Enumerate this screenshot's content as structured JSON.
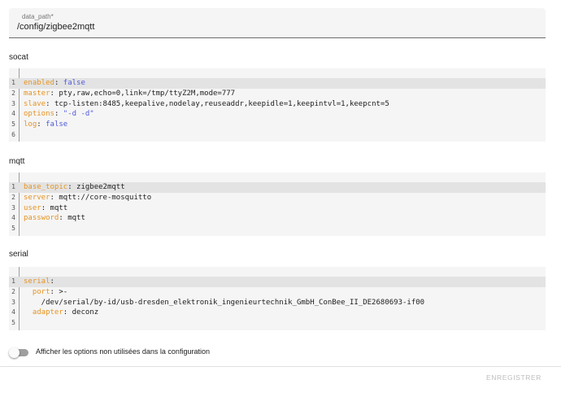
{
  "data_path": {
    "label": "data_path*",
    "value": "/config/zigbee2mqtt"
  },
  "sections": {
    "socat": {
      "title": "socat",
      "lines": [
        {
          "n": "1",
          "key": "enabled",
          "sep": ": ",
          "val": "false",
          "val_type": "bool"
        },
        {
          "n": "2",
          "key": "master",
          "sep": ": ",
          "val": "pty,raw,echo=0,link=/tmp/ttyZ2M,mode=777",
          "val_type": "plain"
        },
        {
          "n": "3",
          "key": "slave",
          "sep": ": ",
          "val": "tcp-listen:8485,keepalive,nodelay,reuseaddr,keepidle=1,keepintvl=1,keepcnt=5",
          "val_type": "plain"
        },
        {
          "n": "4",
          "key": "options",
          "sep": ": ",
          "val": "\"-d -d\"",
          "val_type": "string"
        },
        {
          "n": "5",
          "key": "log",
          "sep": ": ",
          "val": "false",
          "val_type": "bool"
        },
        {
          "n": "6",
          "key": "",
          "sep": "",
          "val": "",
          "val_type": "plain"
        }
      ]
    },
    "mqtt": {
      "title": "mqtt",
      "lines": [
        {
          "n": "1",
          "key": "base_topic",
          "sep": ": ",
          "val": "zigbee2mqtt",
          "val_type": "plain"
        },
        {
          "n": "2",
          "key": "server",
          "sep": ": ",
          "val": "mqtt://core-mosquitto",
          "val_type": "plain"
        },
        {
          "n": "3",
          "key": "user",
          "sep": ": ",
          "val": "mqtt",
          "val_type": "plain"
        },
        {
          "n": "4",
          "key": "password",
          "sep": ": ",
          "val": "mqtt",
          "val_type": "plain"
        },
        {
          "n": "5",
          "key": "",
          "sep": "",
          "val": "",
          "val_type": "plain"
        }
      ]
    },
    "serial": {
      "title": "serial",
      "lines": [
        {
          "n": "1",
          "key": "serial",
          "sep": ":",
          "val": "",
          "val_type": "plain"
        },
        {
          "n": "2",
          "key": "  port",
          "sep": ": ",
          "val": ">-",
          "val_type": "plain"
        },
        {
          "n": "3",
          "key": "",
          "sep": "",
          "val": "    /dev/serial/by-id/usb-dresden_elektronik_ingenieurtechnik_GmbH_ConBee_II_DE2680693-if00",
          "val_type": "plain"
        },
        {
          "n": "4",
          "key": "  adapter",
          "sep": ": ",
          "val": "deconz",
          "val_type": "plain"
        },
        {
          "n": "5",
          "key": "",
          "sep": "",
          "val": "",
          "val_type": "plain"
        }
      ]
    }
  },
  "toggle": {
    "label": "Afficher les options non utilisées dans la configuration",
    "checked": false
  },
  "actions": {
    "save_label": "ENREGISTRER"
  },
  "colors": {
    "key": "#e69422",
    "literal": "#4f59d8",
    "editor_bg": "#f5f5f5",
    "active_line": "#e3e3e3"
  }
}
